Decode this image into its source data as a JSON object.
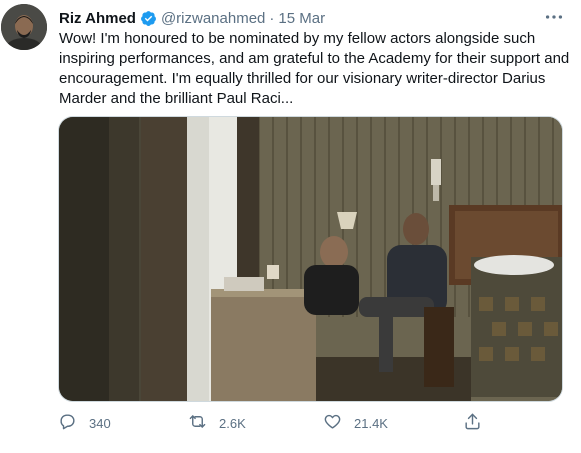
{
  "tweet": {
    "author_name": "Riz Ahmed",
    "handle": "@rizwanahmed",
    "separator": "·",
    "date": "15 Mar",
    "text": "Wow! I'm honoured to be nominated by my fellow actors alongside such inspiring performances, and am grateful to the Academy for their support and encouragement. I'm equally thrilled for our visionary writer-director Darius Marder and the brilliant Paul Raci..."
  },
  "actions": {
    "reply_count": "340",
    "retweet_count": "2.6K",
    "like_count": "21.4K"
  },
  "colors": {
    "text": "#0f1419",
    "secondary": "#5b7083",
    "verified": "#1d9bf0"
  },
  "icons": [
    "more-icon",
    "verified-icon",
    "reply-icon",
    "retweet-icon",
    "like-icon",
    "share-icon"
  ]
}
